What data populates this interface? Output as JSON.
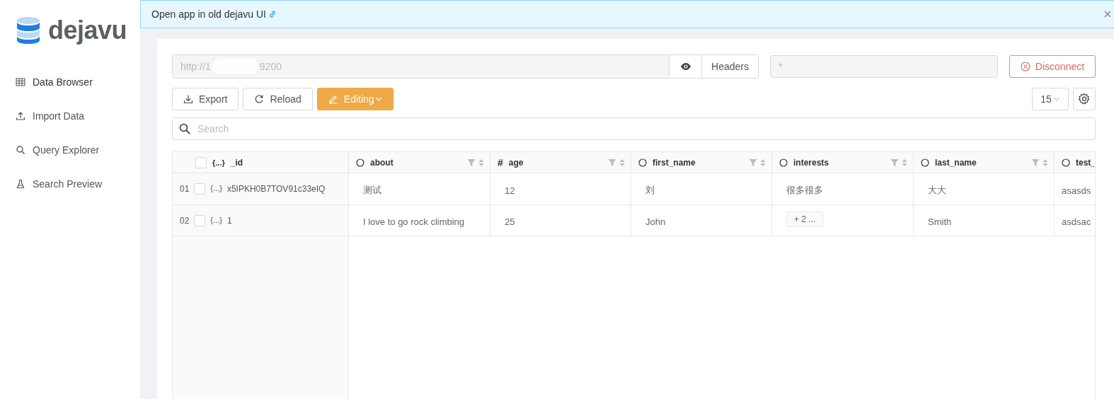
{
  "brand": {
    "name": "dejavu"
  },
  "sidebar": {
    "items": [
      {
        "label": "Data Browser",
        "selected": true
      },
      {
        "label": "Import Data",
        "selected": false
      },
      {
        "label": "Query Explorer",
        "selected": false
      },
      {
        "label": "Search Preview",
        "selected": false
      }
    ]
  },
  "banner": {
    "text": "Open app in old dejavu UI"
  },
  "connection": {
    "url_start": "http://1",
    "url_end": "9200",
    "headers_label": "Headers",
    "credentials_placeholder": "*",
    "disconnect_label": "Disconnect"
  },
  "toolbar": {
    "buttons": [
      {
        "label": "Export"
      },
      {
        "label": "Reload"
      }
    ],
    "editing": {
      "label": "Editing",
      "on": true
    },
    "page_size": "15"
  },
  "search": {
    "placeholder": "Search"
  },
  "table": {
    "id_column": {
      "icon": "{...}",
      "label": "_id"
    },
    "columns": [
      {
        "label": "about",
        "kind": "text"
      },
      {
        "label": "age",
        "kind": "number",
        "symbol": "#"
      },
      {
        "label": "first_name",
        "kind": "text"
      },
      {
        "label": "interests",
        "kind": "text"
      },
      {
        "label": "last_name",
        "kind": "text"
      },
      {
        "label": "test_",
        "kind": "text"
      }
    ],
    "rows": [
      {
        "number": "01",
        "checked": false,
        "icon": "{...}",
        "id": "x5IPKH0B7TOV91c33eIQ",
        "cells": [
          {
            "text": "测试",
            "kind": "plain"
          },
          {
            "text": "12",
            "kind": "plain"
          },
          {
            "text": "刘",
            "kind": "plain"
          },
          {
            "text": "很多很多",
            "kind": "plain"
          },
          {
            "text": "大大",
            "kind": "plain"
          },
          {
            "text": "asasds",
            "kind": "plain"
          }
        ]
      },
      {
        "number": "02",
        "checked": false,
        "icon": "{...}",
        "id": "1",
        "cells": [
          {
            "text": "I love to go rock climbing",
            "kind": "plain"
          },
          {
            "text": "25",
            "kind": "plain"
          },
          {
            "text": "John",
            "kind": "plain"
          },
          {
            "text": "+ 2 ...",
            "kind": "badge"
          },
          {
            "text": "Smith",
            "kind": "plain"
          },
          {
            "text": "asdsac",
            "kind": "plain"
          }
        ]
      }
    ],
    "header_checked": false
  }
}
